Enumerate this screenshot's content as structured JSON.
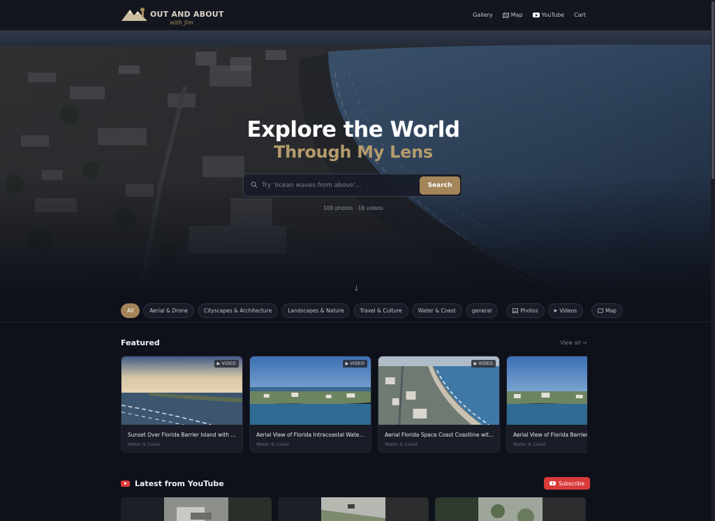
{
  "header": {
    "logo_title": "OUT AND ABOUT",
    "logo_subtitle": "with Jim",
    "nav": [
      {
        "label": "Gallery",
        "icon": null
      },
      {
        "label": "Map",
        "icon": "map-icon"
      },
      {
        "label": "YouTube",
        "icon": "youtube-icon"
      },
      {
        "label": "Cart",
        "icon": null
      }
    ]
  },
  "hero": {
    "title": "Explore the World",
    "subtitle": "Through My Lens",
    "search_placeholder": "Try 'ocean waves from above'...",
    "search_value": "",
    "search_button": "Search",
    "stats": "109 photos · 18 videos"
  },
  "filters": {
    "chips": [
      "All",
      "Aerial & Drone",
      "Cityscapes & Architecture",
      "Landscapes & Nature",
      "Travel & Culture",
      "Water & Coast",
      "general"
    ],
    "media": [
      {
        "label": "Photos",
        "icon": "image-icon"
      },
      {
        "label": "Videos",
        "icon": "play-icon"
      }
    ],
    "map_label": "Map",
    "active": "All"
  },
  "featured": {
    "title": "Featured",
    "view_all": "View all →",
    "cards": [
      {
        "title": "Sunset Over Florida Barrier Island with Oce...",
        "category": "Water & Coast",
        "badge": "VIDEO"
      },
      {
        "title": "Aerial View of Florida Intracoastal Waterwa...",
        "category": "Water & Coast",
        "badge": "VIDEO"
      },
      {
        "title": "Aerial Florida Space Coast Coastline with W...",
        "category": "Water & Coast",
        "badge": "VIDEO"
      },
      {
        "title": "Aerial View of Florida Barrier Isl",
        "category": "Water & Coast",
        "badge": ""
      }
    ]
  },
  "youtube": {
    "title": "Latest from YouTube",
    "subscribe": "Subscribe"
  },
  "colors": {
    "accent": "#a4855a",
    "background": "#0e111a",
    "youtube_red": "#d93a3a"
  }
}
